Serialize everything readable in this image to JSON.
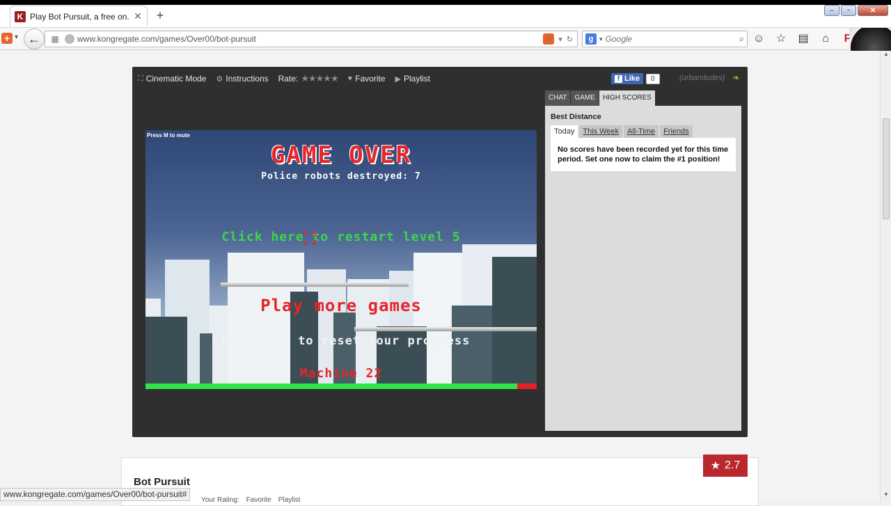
{
  "browser": {
    "tab_title": "Play Bot Pursuit, a free on...",
    "tab_favicon": "K",
    "url": "www.kongregate.com/games/Over00/bot-pursuit",
    "search_placeholder": "Google",
    "status_url": "www.kongregate.com/games/Over00/bot-pursuit#"
  },
  "gamebar": {
    "cinematic": "Cinematic Mode",
    "instructions": "Instructions",
    "rate": "Rate:",
    "favorite": "Favorite",
    "playlist": "Playlist",
    "fb_like": "Like",
    "fb_count": "0",
    "username": "(urbandudes)"
  },
  "game": {
    "mute_hint": "Press M to mute",
    "game_over": "GAME OVER",
    "destroyed": "Police robots destroyed: 7",
    "restart": "Click here to restart level 5",
    "play_more": "Play more games",
    "reset": "Click here to reset your progress",
    "machine": "Machine 22",
    "health_fraction": 0.95
  },
  "sidepanel": {
    "tabs": [
      "CHAT",
      "GAME",
      "HIGH SCORES"
    ],
    "active_tab": "HIGH SCORES",
    "heading": "Best Distance",
    "score_tabs": [
      "Today",
      "This Week",
      "All-Time",
      "Friends"
    ],
    "active_score_tab": "Today",
    "message": "No scores have been recorded yet for this time period. Set one now to claim the #1 position!"
  },
  "info": {
    "title": "Bot Pursuit",
    "rating": "2.7",
    "your_rating": "Your Rating:",
    "favorite": "Favorite",
    "playlist": "Playlist"
  },
  "colors": {
    "accent_red": "#b8282d",
    "game_red": "#e5262b",
    "game_green": "#3cd64a"
  }
}
